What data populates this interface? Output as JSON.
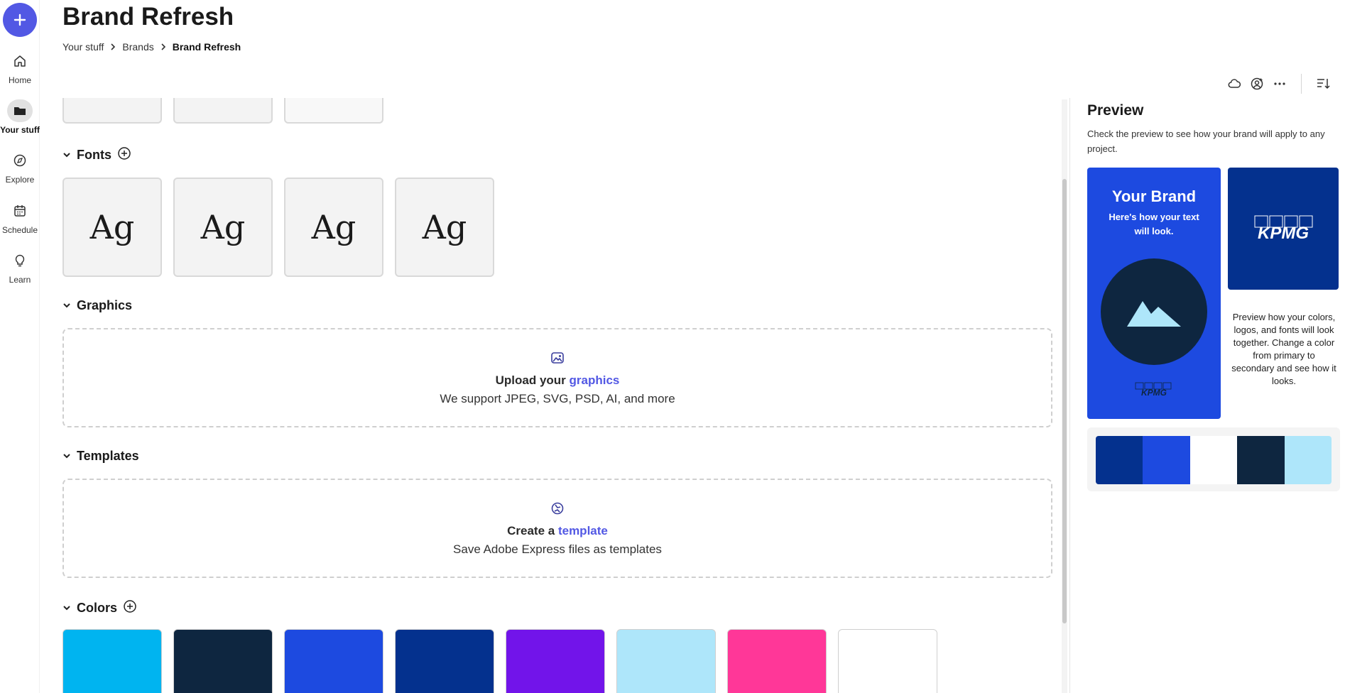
{
  "nav": {
    "items": [
      {
        "label": "Home"
      },
      {
        "label": "Your stuff"
      },
      {
        "label": "Explore"
      },
      {
        "label": "Schedule"
      },
      {
        "label": "Learn"
      }
    ]
  },
  "header": {
    "title": "Brand Refresh",
    "breadcrumb": [
      "Your stuff",
      "Brands",
      "Brand Refresh"
    ]
  },
  "fonts": {
    "heading": "Fonts",
    "samples": [
      "Ag",
      "Ag",
      "Ag",
      "Ag"
    ]
  },
  "graphics": {
    "heading": "Graphics",
    "upload_prefix": "Upload your ",
    "upload_link": "graphics",
    "support_text": "We support JPEG, SVG, PSD, AI, and more"
  },
  "templates": {
    "heading": "Templates",
    "create_prefix": "Create a ",
    "create_link": "template",
    "support_text": "Save Adobe Express files as templates"
  },
  "colors": {
    "heading": "Colors",
    "swatches": [
      "#00b4f0",
      "#0e2640",
      "#1d4ae0",
      "#04318e",
      "#7214ea",
      "#aee6fa",
      "#ff3798",
      "#ffffff"
    ]
  },
  "preview": {
    "title": "Preview",
    "description": "Check the preview to see how your brand will apply to any project.",
    "brand_title": "Your Brand",
    "brand_subtitle": "Here's how your text will look.",
    "logo_text": "KPMG",
    "note": "Preview how your colors, logos, and fonts will look together. Change a color from primary to secondary and see how it looks.",
    "palette": [
      "#04318e",
      "#1d4ae0",
      "#ffffff",
      "#0e2640",
      "#aee6fa"
    ]
  }
}
